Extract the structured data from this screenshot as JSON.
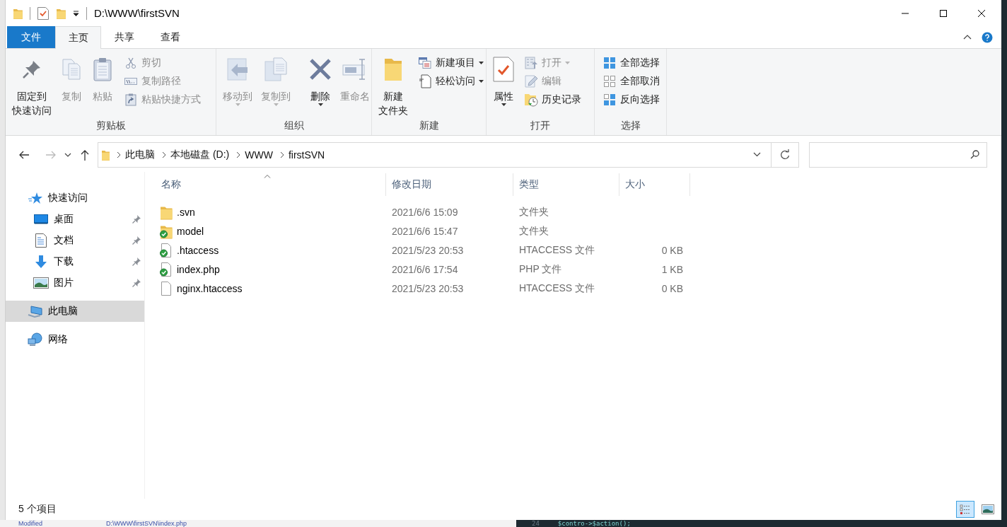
{
  "window": {
    "title": "D:\\WWW\\firstSVN"
  },
  "ribbon_tabs": [
    {
      "label": "文件",
      "kind": "file",
      "selected": false
    },
    {
      "label": "主页",
      "kind": "tab",
      "selected": true
    },
    {
      "label": "共享",
      "kind": "tab",
      "selected": false
    },
    {
      "label": "查看",
      "kind": "tab",
      "selected": false
    }
  ],
  "ribbon_groups": [
    {
      "label": "剪贴板",
      "items": [
        {
          "kind": "large",
          "lines": [
            "固定到",
            "快速访问"
          ],
          "disabled": false,
          "dropdown": false
        },
        {
          "kind": "large",
          "lines": [
            "复制"
          ],
          "disabled": true,
          "dropdown": false
        },
        {
          "kind": "large",
          "lines": [
            "粘贴"
          ],
          "disabled": true,
          "dropdown": false
        },
        {
          "kind": "stack",
          "items": [
            {
              "label": "剪切",
              "disabled": true,
              "dropdown": false
            },
            {
              "label": "复制路径",
              "disabled": true,
              "dropdown": false
            },
            {
              "label": "粘贴快捷方式",
              "disabled": true,
              "dropdown": false
            }
          ]
        }
      ]
    },
    {
      "label": "组织",
      "items": [
        {
          "kind": "large",
          "lines": [
            "移动到"
          ],
          "disabled": true,
          "dropdown": true
        },
        {
          "kind": "large",
          "lines": [
            "复制到"
          ],
          "disabled": true,
          "dropdown": true
        },
        {
          "kind": "separator"
        },
        {
          "kind": "large",
          "lines": [
            "删除"
          ],
          "disabled": false,
          "dropdown": true
        },
        {
          "kind": "large",
          "lines": [
            "重命名"
          ],
          "disabled": true,
          "dropdown": false
        }
      ]
    },
    {
      "label": "新建",
      "items": [
        {
          "kind": "large",
          "lines": [
            "新建",
            "文件夹"
          ],
          "disabled": false,
          "dropdown": false
        },
        {
          "kind": "stack",
          "items": [
            {
              "label": "新建项目",
              "disabled": false,
              "dropdown": true
            },
            {
              "label": "轻松访问",
              "disabled": false,
              "dropdown": true
            }
          ]
        }
      ]
    },
    {
      "label": "打开",
      "items": [
        {
          "kind": "large",
          "lines": [
            "属性"
          ],
          "disabled": false,
          "dropdown": true
        },
        {
          "kind": "stack",
          "items": [
            {
              "label": "打开",
              "disabled": true,
              "dropdown": true
            },
            {
              "label": "编辑",
              "disabled": true,
              "dropdown": false
            },
            {
              "label": "历史记录",
              "disabled": false,
              "dropdown": false
            }
          ]
        }
      ]
    },
    {
      "label": "选择",
      "items": [
        {
          "kind": "stack",
          "items": [
            {
              "label": "全部选择",
              "disabled": false,
              "dropdown": false
            },
            {
              "label": "全部取消",
              "disabled": false,
              "dropdown": false
            },
            {
              "label": "反向选择",
              "disabled": false,
              "dropdown": false
            }
          ]
        }
      ]
    }
  ],
  "breadcrumbs": [
    "此电脑",
    "本地磁盘 (D:)",
    "WWW",
    "firstSVN"
  ],
  "nav_pane": [
    {
      "label": "快速访问",
      "selected": false,
      "children": [
        {
          "label": "桌面",
          "pinned": true,
          "selected": false
        },
        {
          "label": "文档",
          "pinned": true,
          "selected": false
        },
        {
          "label": "下载",
          "pinned": true,
          "selected": false
        },
        {
          "label": "图片",
          "pinned": true,
          "selected": false
        }
      ]
    },
    {
      "label": "此电脑",
      "selected": true
    },
    {
      "label": "网络",
      "selected": false
    }
  ],
  "columns": [
    {
      "label": "名称",
      "sorted": true
    },
    {
      "label": "修改日期",
      "sorted": false
    },
    {
      "label": "类型",
      "sorted": false
    },
    {
      "label": "大小",
      "sorted": false
    }
  ],
  "files": [
    {
      "name": ".svn",
      "date": "2021/6/6 15:09",
      "type": "文件夹",
      "kind": "folder",
      "svn_normal": false
    },
    {
      "name": "model",
      "date": "2021/6/6 15:47",
      "type": "文件夹",
      "kind": "folder",
      "svn_normal": true
    },
    {
      "name": ".htaccess",
      "date": "2021/5/23 20:53",
      "type": "HTACCESS 文件",
      "size": "0 KB",
      "kind": "file",
      "svn_normal": true
    },
    {
      "name": "index.php",
      "date": "2021/6/6 17:54",
      "type": "PHP 文件",
      "size": "1 KB",
      "kind": "file",
      "svn_normal": true
    },
    {
      "name": "nginx.htaccess",
      "date": "2021/5/23 20:53",
      "type": "HTACCESS 文件",
      "size": "0 KB",
      "kind": "file",
      "svn_normal": false
    }
  ],
  "status_bar": {
    "item_count": "5 个项目",
    "views": [
      {
        "kind": "details",
        "selected": true
      },
      {
        "kind": "large_icons",
        "selected": false
      }
    ]
  },
  "background": {
    "footer_label": "Modified",
    "footer_path": "D:\\WWW\\firstSVN\\index.php",
    "line_number": "24",
    "code": "$contro->$action();"
  }
}
